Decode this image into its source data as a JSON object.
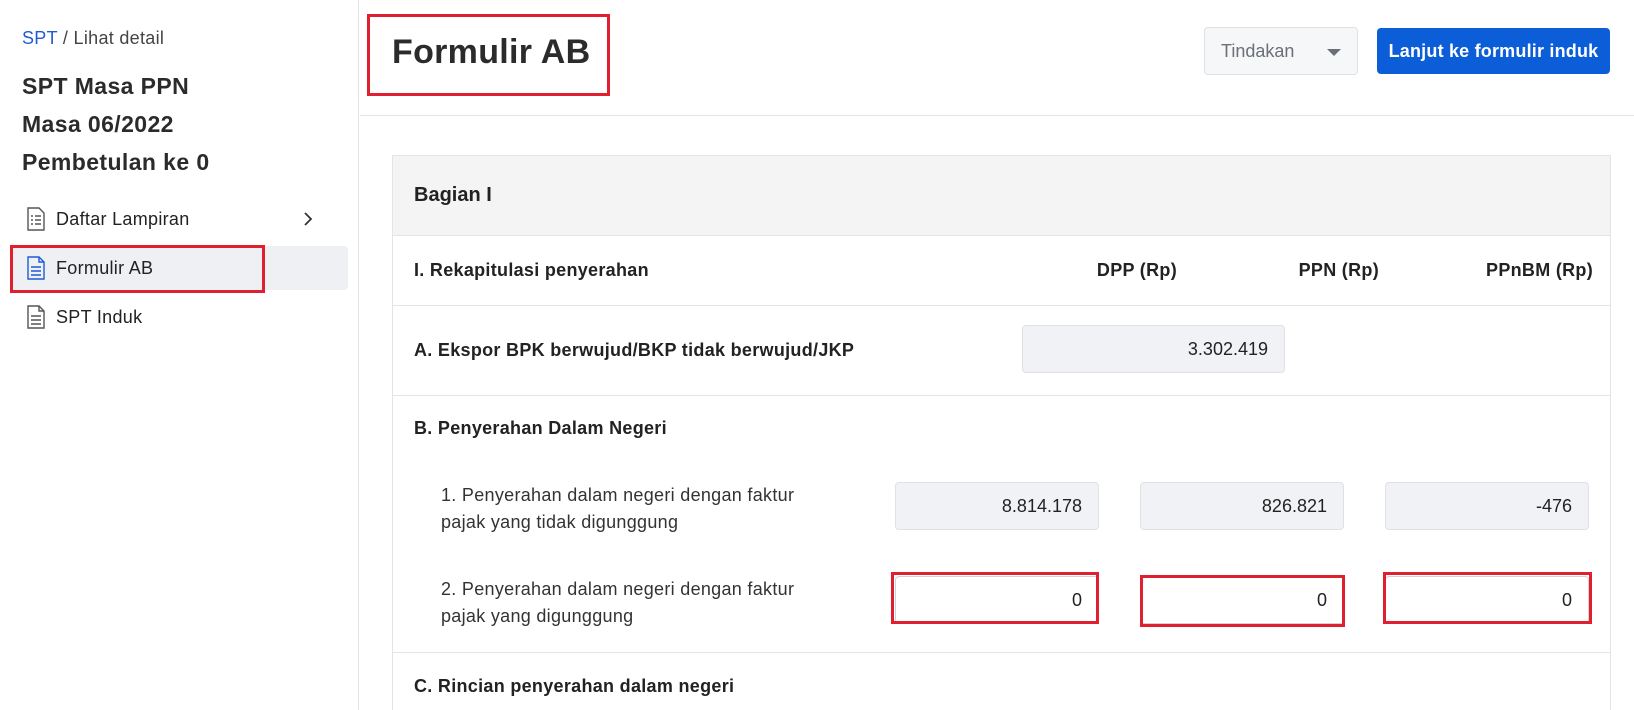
{
  "breadcrumb": {
    "link": "SPT",
    "separator": "/",
    "current": "Lihat detail"
  },
  "sidebar": {
    "title_line1": "SPT Masa PPN",
    "title_line2": "Masa 06/2022",
    "title_line3": "Pembetulan ke 0",
    "items": [
      {
        "label": "Daftar Lampiran",
        "icon": "list-document-icon",
        "has_chevron": true
      },
      {
        "label": "Formulir AB",
        "icon": "document-icon",
        "active": true
      },
      {
        "label": "SPT Induk",
        "icon": "document-icon"
      }
    ]
  },
  "header": {
    "title": "Formulir AB",
    "action_select": "Tindakan",
    "primary_button": "Lanjut ke formulir induk"
  },
  "section": {
    "title": "Bagian I",
    "recap_label": "I. Rekapitulasi penyerahan",
    "columns": [
      "DPP (Rp)",
      "PPN (Rp)",
      "PPnBM (Rp)"
    ],
    "row_a": {
      "label": "A. Ekspor BPK berwujud/BKP tidak berwujud/JKP",
      "dpp": "3.302.419"
    },
    "row_b": {
      "label": "B. Penyerahan Dalam Negeri",
      "item1": {
        "label_line1": "1. Penyerahan dalam negeri dengan faktur",
        "label_line2": "pajak yang tidak digunggung",
        "dpp": "8.814.178",
        "ppn": "826.821",
        "ppnbm": "-476"
      },
      "item2": {
        "label_line1": "2. Penyerahan dalam negeri dengan faktur",
        "label_line2": "pajak yang digunggung",
        "dpp": "0",
        "ppn": "0",
        "ppnbm": "0"
      }
    },
    "row_c": {
      "label": "C. Rincian penyerahan dalam negeri"
    }
  },
  "colors": {
    "accent": "#0b5ed7",
    "highlight": "#e0202e",
    "link": "#1f5bd6"
  }
}
